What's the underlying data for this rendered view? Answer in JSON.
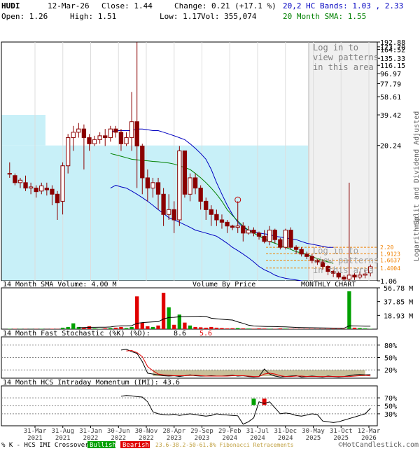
{
  "header": {
    "symbol": "HUDI",
    "date": "12-Mar-26",
    "close_label": "Close: 1.44",
    "change_label": "Change: 0.21 (+17.1 %)",
    "bands_label": "20,2 HC Bands: 1.03 , 2.33",
    "open_label": "Open: 1.26",
    "high_label": "High: 1.51",
    "low_label": "Low: 1.17",
    "vol_label": "Vol: 355,074",
    "sma_label": "20 Month SMA: 1.55"
  },
  "colors": {
    "bullish": "#00a000",
    "bearish": "#e00000",
    "candle": "#8b0000",
    "upper_band": "#0000c0",
    "sma_line": "#008000",
    "volume_by_price": "#c8f0f8",
    "fib_band": "#c8c09a",
    "grid": "#dddddd",
    "border": "#000000"
  },
  "main_panel": {
    "scale": "log",
    "y_ticks": [
      "192.88",
      "173.70",
      "164.52",
      "135.33",
      "116.15",
      "96.97",
      "77.79",
      "58.61",
      "39.42",
      "20.24",
      "1.06"
    ],
    "fib_levels": [
      "2.20",
      "1.9123",
      "1.6637",
      "1.4004"
    ],
    "side_label_top": "Split and Dividend Adjusted",
    "side_label_bottom": "Logarithmic",
    "login_text": "Log in to view patterns in this area",
    "volume_by_price_label": "Volume By Price",
    "monthly_label": "MONTHLY CHART"
  },
  "volume_panel": {
    "label": "14 Month SMA Volume: 4.00 M",
    "y_ticks": [
      "56.78 M",
      "37.85 M",
      "18.93 M"
    ]
  },
  "stochastic_panel": {
    "label_prefix": "14 Month Fast Stochastic (%K) (%D):",
    "k_value": "8.6",
    "d_value": "5.6",
    "y_ticks": [
      "80%",
      "50%",
      "20%"
    ]
  },
  "momentum_panel": {
    "label": "14 Month HCS Intraday Momentum (IMI): 43.6",
    "y_ticks": [
      "70%",
      "50%",
      "30%"
    ]
  },
  "x_axis": {
    "ticks": [
      {
        "month": "31-Mar",
        "year": "2021"
      },
      {
        "month": "31-Aug",
        "year": "2021"
      },
      {
        "month": "31-Jan",
        "year": "2022"
      },
      {
        "month": "30-Jun",
        "year": "2022"
      },
      {
        "month": "30-Nov",
        "year": "2022"
      },
      {
        "month": "28-Apr",
        "year": "2023"
      },
      {
        "month": "29-Sep",
        "year": "2023"
      },
      {
        "month": "29-Feb",
        "year": "2024"
      },
      {
        "month": "31-Jul",
        "year": "2024"
      },
      {
        "month": "31-Dec",
        "year": "2024"
      },
      {
        "month": "30-May",
        "year": "2025"
      },
      {
        "month": "31-Oct",
        "year": "2025"
      },
      {
        "month": "12-Mar",
        "year": "2026"
      }
    ]
  },
  "footer": {
    "crossover_label": "% K - HCS IMI Crossover,",
    "bullish_label": "Bullish",
    "bearish_label": "Bearish",
    "fib_label": "23.6-38.2-50-61.8% Fibonacci Retracements",
    "brand": "©HotCandlestick.com"
  },
  "chart_data": [
    {
      "type": "candlestick",
      "panel": "price",
      "y_scale": "log",
      "ylim": [
        1.06,
        192.88
      ],
      "series": [
        {
          "name": "Price",
          "ohlc": [
            [
              11,
              11,
              14,
              10
            ],
            [
              10.5,
              9,
              11,
              8.5
            ],
            [
              9,
              9.5,
              10,
              8
            ],
            [
              9,
              8,
              10.5,
              7.5
            ],
            [
              8,
              8.2,
              9,
              7
            ],
            [
              8,
              7.4,
              8.5,
              6.5
            ],
            [
              7.5,
              8.4,
              9,
              7
            ],
            [
              8,
              7.7,
              9,
              6.8
            ],
            [
              7.8,
              7,
              8.5,
              5.5
            ],
            [
              7,
              5.8,
              7.5,
              4
            ],
            [
              6,
              13,
              14,
              4.5
            ],
            [
              13,
              24,
              26,
              11
            ],
            [
              24,
              27,
              31,
              18
            ],
            [
              27,
              29,
              33,
              24
            ],
            [
              29,
              24,
              32,
              12
            ],
            [
              24,
              21,
              26,
              18
            ],
            [
              21,
              23,
              25,
              20
            ],
            [
              23,
              25,
              27,
              21
            ],
            [
              25,
              24,
              29,
              20
            ],
            [
              24,
              29,
              31,
              22
            ],
            [
              29,
              27,
              31,
              24
            ],
            [
              27,
              21,
              29,
              18
            ],
            [
              21,
              24,
              27,
              20
            ],
            [
              24,
              34,
              65,
              18
            ],
            [
              34,
              20,
              192,
              8
            ],
            [
              20,
              10,
              21,
              7
            ],
            [
              10,
              8,
              12,
              6
            ],
            [
              8,
              9,
              10,
              6.5
            ],
            [
              9,
              7,
              10,
              5
            ],
            [
              7,
              4.5,
              8,
              3.5
            ],
            [
              4.5,
              5,
              7,
              4
            ],
            [
              5,
              4,
              6,
              3
            ],
            [
              4,
              18,
              20,
              3.5
            ],
            [
              18,
              7,
              18,
              6.5
            ],
            [
              7,
              10,
              11,
              6
            ],
            [
              10,
              8,
              11,
              7
            ],
            [
              8,
              6,
              8.5,
              5
            ],
            [
              6,
              5,
              6.5,
              4
            ],
            [
              5,
              4.5,
              5.5,
              3.5
            ],
            [
              4.5,
              4,
              5,
              3.5
            ],
            [
              4,
              3.8,
              4.5,
              3.3
            ],
            [
              3.8,
              3.5,
              4,
              3
            ],
            [
              3.5,
              3.4,
              3.6,
              3.2
            ],
            [
              3.4,
              3.5,
              6,
              3
            ],
            [
              3.5,
              3,
              3.8,
              2.5
            ],
            [
              3,
              3.2,
              3.5,
              2.9
            ],
            [
              3.2,
              3,
              3.4,
              2.8
            ],
            [
              3,
              2.8,
              3.1,
              2.6
            ],
            [
              2.8,
              2.5,
              3.2,
              2.4
            ],
            [
              2.5,
              3.2,
              3.5,
              2.3
            ],
            [
              3.2,
              2.6,
              3.3,
              2.4
            ],
            [
              2.6,
              2.2,
              2.7,
              2.1
            ],
            [
              2.2,
              3.2,
              3.3,
              2.1
            ],
            [
              3.2,
              2.2,
              3.4,
              2.1
            ],
            [
              2.2,
              2.1,
              2.3,
              1.9
            ],
            [
              2.1,
              1.9,
              2.2,
              1.8
            ],
            [
              1.9,
              1.8,
              2,
              1.7
            ],
            [
              1.8,
              1.65,
              1.9,
              1.55
            ],
            [
              1.65,
              1.6,
              1.7,
              1.5
            ],
            [
              1.6,
              1.45,
              1.7,
              1.35
            ],
            [
              1.45,
              1.3,
              1.5,
              1.2
            ],
            [
              1.3,
              1.25,
              1.35,
              1.15
            ],
            [
              1.25,
              1.15,
              1.3,
              1.1
            ],
            [
              1.15,
              1.1,
              1.2,
              1.05
            ],
            [
              1.1,
              1.2,
              9,
              1.05
            ],
            [
              1.2,
              1.15,
              1.25,
              1.08
            ],
            [
              1.15,
              1.2,
              1.3,
              1.1
            ],
            [
              1.2,
              1.23,
              1.35,
              1.12
            ],
            [
              1.26,
              1.44,
              1.51,
              1.17
            ]
          ]
        },
        {
          "name": "Upper band",
          "values": [
            null,
            null,
            null,
            null,
            null,
            null,
            null,
            null,
            null,
            null,
            null,
            null,
            null,
            null,
            null,
            null,
            null,
            null,
            null,
            27,
            28,
            28,
            28,
            28,
            29,
            29,
            28.5,
            28,
            28,
            27,
            26,
            25,
            24,
            23,
            21,
            19,
            17,
            15,
            12,
            9,
            7,
            5.5,
            4.5,
            3.8,
            3.4,
            3.2,
            3.1,
            3,
            2.95,
            2.9,
            2.8,
            2.75,
            2.7,
            2.65,
            2.6,
            2.5,
            2.4,
            2.35,
            2.3,
            2.25,
            2.2,
            2.2
          ]
        },
        {
          "name": "20 Month SMA",
          "values": [
            null,
            null,
            null,
            null,
            null,
            null,
            null,
            null,
            null,
            null,
            null,
            null,
            null,
            null,
            null,
            null,
            null,
            null,
            null,
            17,
            16.5,
            16,
            15.5,
            15,
            14.8,
            14.6,
            14.5,
            14.3,
            14.2,
            14,
            13.8,
            13.5,
            13,
            12.5,
            12,
            11,
            10,
            9,
            8,
            7,
            6,
            5,
            4.4,
            3.9,
            3.5,
            3.2,
            3,
            2.8,
            2.65,
            2.5,
            2.4,
            2.3,
            2.2,
            2.1,
            2,
            1.95,
            1.9,
            1.8,
            1.72,
            1.66,
            1.6,
            1.55
          ]
        },
        {
          "name": "Lower band",
          "values": [
            null,
            null,
            null,
            null,
            null,
            null,
            null,
            null,
            null,
            null,
            null,
            null,
            null,
            null,
            null,
            null,
            null,
            null,
            null,
            8,
            8.5,
            8.2,
            8,
            7.5,
            7,
            6.5,
            6,
            5.5,
            5,
            4.6,
            4.2,
            4,
            3.8,
            3.6,
            3.4,
            3.2,
            3.1,
            3,
            2.9,
            2.8,
            2.6,
            2.4,
            2.2,
            2.05,
            1.9,
            1.75,
            1.6,
            1.45,
            1.35,
            1.28,
            1.2,
            1.15,
            1.12,
            1.1,
            1.08,
            1.06,
            1.04,
            1.03,
            1.03,
            1.03,
            1.03,
            1.03
          ]
        }
      ]
    },
    {
      "type": "bar",
      "panel": "volume",
      "ylim": [
        0,
        56.78
      ],
      "series": [
        {
          "name": "Volume",
          "values": [
            0.5,
            0.4,
            0.3,
            0.3,
            0.2,
            0.3,
            0.4,
            0.2,
            0.5,
            0.3,
            2,
            3,
            8,
            3,
            2,
            4,
            1,
            0.5,
            1,
            1.5,
            2,
            3,
            1.5,
            3,
            45,
            9,
            4,
            3,
            5,
            50,
            30,
            6,
            20,
            9,
            5,
            3,
            2.5,
            2,
            3,
            2,
            1.5,
            1,
            1.2,
            1.5,
            1,
            0.8,
            0.6,
            1,
            0.8,
            0.6,
            0.5,
            1,
            0.7,
            0.5,
            0.5,
            0.4,
            0.5,
            0.5,
            0.4,
            0.4,
            0.5,
            0.6,
            0.5,
            0.4,
            52,
            2,
            1.5,
            1,
            0.4
          ]
        },
        {
          "name": "SMA Volume",
          "values": [
            null,
            null,
            null,
            null,
            null,
            null,
            null,
            null,
            null,
            null,
            null,
            null,
            null,
            2,
            2.2,
            2.5,
            2.5,
            2.6,
            2.7,
            3,
            4,
            4.5,
            4.6,
            4.8,
            8,
            9,
            9.5,
            10,
            10.2,
            14,
            16,
            16.3,
            17,
            17.2,
            17.4,
            17.6,
            17.8,
            17.4,
            15,
            14.2,
            13.6,
            13,
            12.5,
            10,
            8,
            5.5,
            4.3,
            4,
            3.8,
            3.6,
            3.5,
            3.3,
            3.2,
            2.8,
            2.4,
            2.2,
            2,
            1.9,
            1.8,
            1.6,
            1.5,
            1.4,
            1.3,
            1.2,
            4.5,
            4.4,
            4.3,
            4.1,
            4
          ]
        }
      ]
    },
    {
      "type": "line",
      "panel": "stochastic",
      "ylim": [
        0,
        100
      ],
      "series": [
        {
          "name": "%K",
          "values": [
            null,
            null,
            null,
            null,
            null,
            null,
            null,
            null,
            null,
            null,
            null,
            null,
            null,
            null,
            null,
            null,
            null,
            null,
            null,
            null,
            null,
            68,
            70,
            64,
            60,
            40,
            12,
            10,
            8,
            6,
            5,
            6,
            4,
            6,
            8,
            6,
            5,
            5,
            6,
            5,
            5,
            6,
            7,
            5,
            6,
            4,
            3,
            4,
            22,
            10,
            5,
            3,
            4,
            5,
            6,
            3,
            4,
            5,
            4,
            3,
            5,
            4,
            3,
            4,
            6,
            8,
            9,
            8,
            8.6
          ]
        },
        {
          "name": "%D",
          "values": [
            null,
            null,
            null,
            null,
            null,
            null,
            null,
            null,
            null,
            null,
            null,
            null,
            null,
            null,
            null,
            null,
            null,
            null,
            null,
            null,
            null,
            null,
            66,
            67,
            62,
            52,
            28,
            18,
            10,
            8,
            7,
            6,
            6,
            6,
            7,
            7,
            6,
            5,
            5,
            5,
            5,
            5,
            6,
            6,
            6,
            5,
            4,
            4,
            10,
            12,
            10,
            6,
            4,
            4,
            5,
            5,
            4,
            4,
            4,
            4,
            4,
            4,
            4,
            4,
            4,
            5,
            6,
            7,
            5.6
          ]
        }
      ]
    },
    {
      "type": "line",
      "panel": "momentum",
      "ylim": [
        0,
        100
      ],
      "series": [
        {
          "name": "IMI",
          "values": [
            null,
            null,
            null,
            null,
            null,
            null,
            null,
            null,
            null,
            null,
            null,
            null,
            null,
            null,
            null,
            null,
            null,
            null,
            null,
            null,
            null,
            74,
            76,
            75,
            73,
            72,
            60,
            35,
            30,
            28,
            27,
            29,
            26,
            28,
            30,
            28,
            26,
            24,
            26,
            30,
            28,
            27,
            26,
            25,
            4,
            10,
            20,
            60,
            56,
            60,
            45,
            30,
            32,
            30,
            26,
            24,
            27,
            30,
            28,
            12,
            10,
            8,
            10,
            14,
            18,
            22,
            26,
            30,
            43.6
          ]
        }
      ]
    }
  ]
}
